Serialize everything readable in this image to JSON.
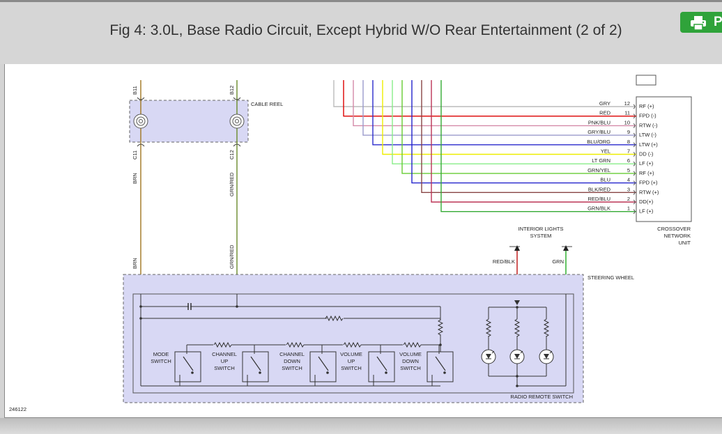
{
  "header": {
    "title": "Fig 4: 3.0L, Base Radio Circuit, Except Hybrid W/O Rear Entertainment (2 of 2)",
    "print_label": "P",
    "print_icon": "printer-icon",
    "accent_color": "#2fa33a"
  },
  "diagram": {
    "figure_number": "246122",
    "cable_reel": {
      "label": "CABLE REEL",
      "pin_top_left": "B11",
      "pin_top_right": "B12",
      "pin_bottom_left": "C11",
      "pin_bottom_right": "C12"
    },
    "wires_left": {
      "brn": "BRN",
      "grn_red": "GRN/RED"
    },
    "crossover": {
      "label_line1": "CROSSOVER",
      "label_line2": "NETWORK",
      "label_line3": "UNIT",
      "pins": [
        {
          "wire": "GRY",
          "num": "12",
          "func": "RF (+)",
          "color": "#bbbbbb"
        },
        {
          "wire": "RED",
          "num": "11",
          "func": "FPD (-)",
          "color": "#dd0000"
        },
        {
          "wire": "PNK/BLU",
          "num": "10",
          "func": "RTW (-)",
          "color": "#d48aa8"
        },
        {
          "wire": "GRY/BLU",
          "num": "9",
          "func": "LTW (-)",
          "color": "#9a9acc"
        },
        {
          "wire": "BLU/ORG",
          "num": "8",
          "func": "LTW (+)",
          "color": "#2a2acc"
        },
        {
          "wire": "YEL",
          "num": "7",
          "func": "DD (-)",
          "color": "#eeee00"
        },
        {
          "wire": "LT GRN",
          "num": "6",
          "func": "LF (+)",
          "color": "#88ee88"
        },
        {
          "wire": "GRN/YEL",
          "num": "5",
          "func": "RF (+)",
          "color": "#66cc33"
        },
        {
          "wire": "BLU",
          "num": "4",
          "func": "FPD (+)",
          "color": "#2222cc"
        },
        {
          "wire": "BLK/RED",
          "num": "3",
          "func": "RTW (+)",
          "color": "#884444"
        },
        {
          "wire": "RED/BLU",
          "num": "2",
          "func": "DD(+)",
          "color": "#bb3355"
        },
        {
          "wire": "GRN/BLK",
          "num": "1",
          "func": "LF (+)",
          "color": "#33aa33"
        }
      ]
    },
    "interior_lights": {
      "label_line1": "INTERIOR LIGHTS",
      "label_line2": "SYSTEM",
      "wire_left": "RED/BLK",
      "wire_right": "GRN"
    },
    "steering_wheel_label": "STEERING WHEEL",
    "radio_remote_label": "RADIO REMOTE SWITCH",
    "switches": [
      {
        "line1": "MODE",
        "line2": "SWITCH",
        "line3": ""
      },
      {
        "line1": "CHANNEL",
        "line2": "UP",
        "line3": "SWITCH"
      },
      {
        "line1": "CHANNEL",
        "line2": "DOWN",
        "line3": "SWITCH"
      },
      {
        "line1": "VOLUME",
        "line2": "UP",
        "line3": "SWITCH"
      },
      {
        "line1": "VOLUME",
        "line2": "DOWN",
        "line3": "SWITCH"
      }
    ]
  }
}
